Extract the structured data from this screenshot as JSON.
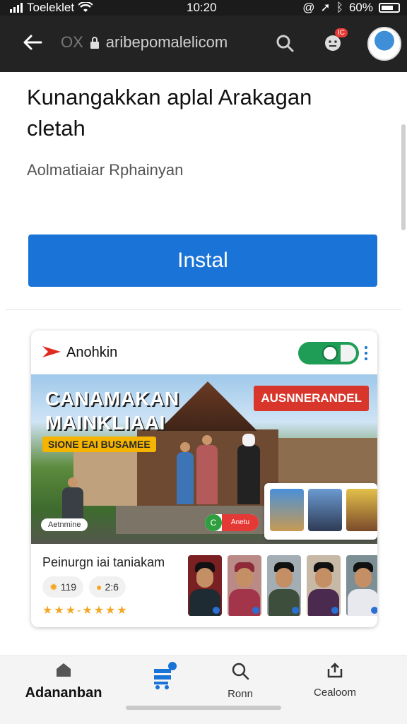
{
  "status_bar": {
    "carrier": "Toeleklet",
    "time": "10:20",
    "battery": "60%"
  },
  "browser": {
    "url_prefix": "OX",
    "url": "aribepomalelicom",
    "notification_badge": "IC"
  },
  "page": {
    "title_line1": "Kunangakkan aplal Arakagan",
    "title_line2": "cletah",
    "subtitle": "Aolmatiaiar Rphainyan",
    "install_label": "Instal"
  },
  "card": {
    "brand": "Anohkin",
    "toggle_on": true,
    "banner": {
      "headline_line1": "CANAMAKAN",
      "headline_line2": "MAINKLIAAI",
      "tagline": "SIONE EAI BUSAMEE",
      "red_tag": "AUSNNERANDEL",
      "left_pill": "Aetnmine",
      "mid_pill": "Anetu"
    },
    "footer": {
      "title": "Peinurgn iai taniakam",
      "chip1": "119",
      "chip2": "2:6",
      "stars": "★★★-★★★★"
    }
  },
  "bottom_nav": {
    "items": [
      {
        "label": "Adananban",
        "icon": "home-icon"
      },
      {
        "label": "",
        "icon": "cart-icon"
      },
      {
        "label": "Ronn",
        "icon": "search-icon"
      },
      {
        "label": "Cealoom",
        "icon": "share-icon"
      }
    ]
  },
  "colors": {
    "accent": "#1a73d6",
    "toggle": "#1f9d57",
    "dark_bar": "#232323"
  }
}
